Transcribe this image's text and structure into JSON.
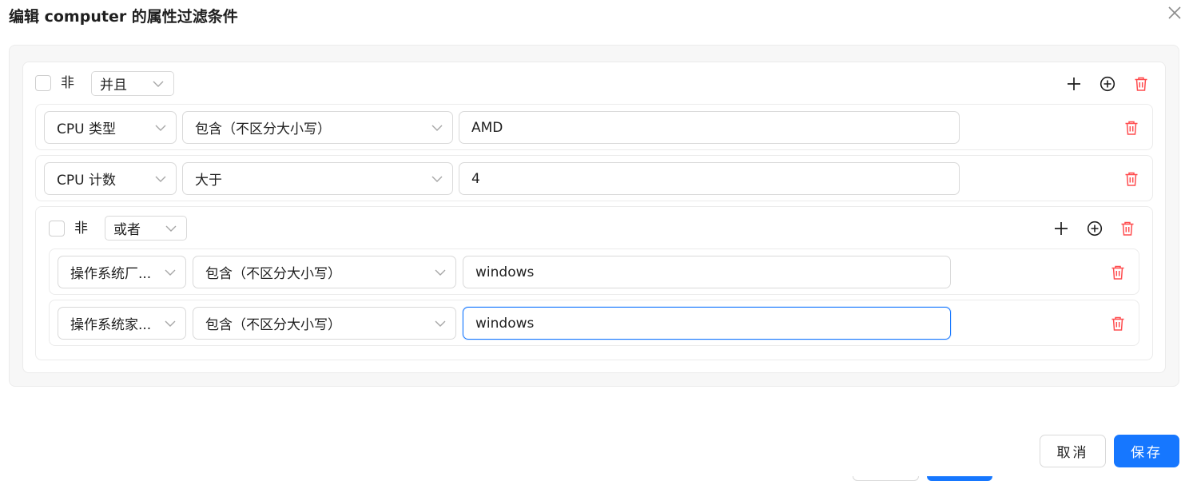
{
  "dialog": {
    "title": "编辑 computer 的属性过滤条件",
    "close_icon": "close-icon"
  },
  "root_group": {
    "not_label": "非",
    "operator": "并且",
    "conditions": [
      {
        "field": "CPU 类型",
        "operator": "包含（不区分大小写）",
        "value": "AMD"
      },
      {
        "field": "CPU 计数",
        "operator": "大于",
        "value": "4"
      }
    ],
    "nested_group": {
      "not_label": "非",
      "operator": "或者",
      "conditions": [
        {
          "field": "操作系统厂...",
          "operator": "包含（不区分大小写）",
          "value": "windows"
        },
        {
          "field": "操作系统家...",
          "operator": "包含（不区分大小写）",
          "value": "windows"
        }
      ]
    }
  },
  "footer": {
    "cancel_label": "取消",
    "save_label": "保存"
  },
  "colors": {
    "primary": "#1677ff",
    "danger": "#ff4d4f"
  }
}
